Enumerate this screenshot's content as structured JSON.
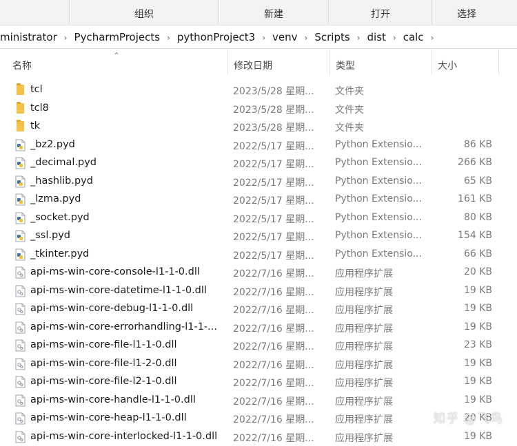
{
  "ribbon": {
    "groups": [
      "组织",
      "新建",
      "打开",
      "选择"
    ]
  },
  "address": {
    "crumbs": [
      "ministrator",
      "PycharmProjects",
      "pythonProject3",
      "venv",
      "Scripts",
      "dist",
      "calc"
    ]
  },
  "columns": {
    "name": "名称",
    "date": "修改日期",
    "type": "类型",
    "size": "大小"
  },
  "files": [
    {
      "name": "tcl",
      "date": "2023/5/28 星期...",
      "type": "文件夹",
      "size": "",
      "icon": "folder-icon"
    },
    {
      "name": "tcl8",
      "date": "2023/5/28 星期...",
      "type": "文件夹",
      "size": "",
      "icon": "folder-icon"
    },
    {
      "name": "tk",
      "date": "2023/5/28 星期...",
      "type": "文件夹",
      "size": "",
      "icon": "folder-icon"
    },
    {
      "name": "_bz2.pyd",
      "date": "2022/5/17 星期...",
      "type": "Python Extensio...",
      "size": "86 KB",
      "icon": "python-file-icon"
    },
    {
      "name": "_decimal.pyd",
      "date": "2022/5/17 星期...",
      "type": "Python Extensio...",
      "size": "266 KB",
      "icon": "python-file-icon"
    },
    {
      "name": "_hashlib.pyd",
      "date": "2022/5/17 星期...",
      "type": "Python Extensio...",
      "size": "65 KB",
      "icon": "python-file-icon"
    },
    {
      "name": "_lzma.pyd",
      "date": "2022/5/17 星期...",
      "type": "Python Extensio...",
      "size": "161 KB",
      "icon": "python-file-icon"
    },
    {
      "name": "_socket.pyd",
      "date": "2022/5/17 星期...",
      "type": "Python Extensio...",
      "size": "80 KB",
      "icon": "python-file-icon"
    },
    {
      "name": "_ssl.pyd",
      "date": "2022/5/17 星期...",
      "type": "Python Extensio...",
      "size": "154 KB",
      "icon": "python-file-icon"
    },
    {
      "name": "_tkinter.pyd",
      "date": "2022/5/17 星期...",
      "type": "Python Extensio...",
      "size": "66 KB",
      "icon": "python-file-icon"
    },
    {
      "name": "api-ms-win-core-console-l1-1-0.dll",
      "date": "2022/7/16 星期...",
      "type": "应用程序扩展",
      "size": "20 KB",
      "icon": "dll-file-icon"
    },
    {
      "name": "api-ms-win-core-datetime-l1-1-0.dll",
      "date": "2022/7/16 星期...",
      "type": "应用程序扩展",
      "size": "19 KB",
      "icon": "dll-file-icon"
    },
    {
      "name": "api-ms-win-core-debug-l1-1-0.dll",
      "date": "2022/7/16 星期...",
      "type": "应用程序扩展",
      "size": "19 KB",
      "icon": "dll-file-icon"
    },
    {
      "name": "api-ms-win-core-errorhandling-l1-1-...",
      "date": "2022/7/16 星期...",
      "type": "应用程序扩展",
      "size": "19 KB",
      "icon": "dll-file-icon"
    },
    {
      "name": "api-ms-win-core-file-l1-1-0.dll",
      "date": "2022/7/16 星期...",
      "type": "应用程序扩展",
      "size": "23 KB",
      "icon": "dll-file-icon"
    },
    {
      "name": "api-ms-win-core-file-l1-2-0.dll",
      "date": "2022/7/16 星期...",
      "type": "应用程序扩展",
      "size": "19 KB",
      "icon": "dll-file-icon"
    },
    {
      "name": "api-ms-win-core-file-l2-1-0.dll",
      "date": "2022/7/16 星期...",
      "type": "应用程序扩展",
      "size": "19 KB",
      "icon": "dll-file-icon"
    },
    {
      "name": "api-ms-win-core-handle-l1-1-0.dll",
      "date": "2022/7/16 星期...",
      "type": "应用程序扩展",
      "size": "19 KB",
      "icon": "dll-file-icon"
    },
    {
      "name": "api-ms-win-core-heap-l1-1-0.dll",
      "date": "2022/7/16 星期...",
      "type": "应用程序扩展",
      "size": "20 KB",
      "icon": "dll-file-icon"
    },
    {
      "name": "api-ms-win-core-interlocked-l1-1-0.dll",
      "date": "2022/7/16 星期...",
      "type": "应用程序扩展",
      "size": "19 KB",
      "icon": "dll-file-icon"
    }
  ],
  "watermark": "知乎 @飞鸟",
  "colors": {
    "folder": "#f4c248",
    "python_blue": "#3a75b0",
    "python_yellow": "#f2c230",
    "muted_text": "#7a7a7a"
  }
}
